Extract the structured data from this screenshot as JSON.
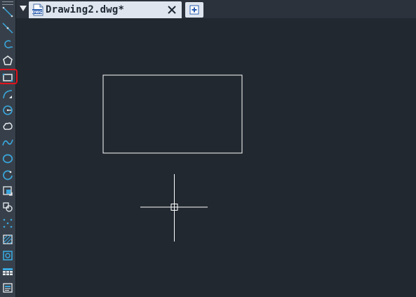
{
  "tab": {
    "title": "Drawing2.dwg*",
    "icon_label": "DWG"
  },
  "colors": {
    "canvas_bg": "#212830",
    "toolbar_bg": "#37404a",
    "tab_bg": "#dfe5ee",
    "accent": "#3aa7de",
    "highlight": "#e0141e"
  },
  "toolbar": {
    "tools": [
      {
        "name": "line-tool-icon"
      },
      {
        "name": "construction-line-tool-icon"
      },
      {
        "name": "polyline-tool-icon"
      },
      {
        "name": "polygon-tool-icon"
      },
      {
        "name": "rectangle-tool-icon",
        "selected": true
      },
      {
        "name": "arc-tool-icon"
      },
      {
        "name": "circle-tool-icon"
      },
      {
        "name": "revision-cloud-tool-icon"
      },
      {
        "name": "spline-tool-icon"
      },
      {
        "name": "ellipse-tool-icon"
      },
      {
        "name": "ellipse-arc-tool-icon"
      },
      {
        "name": "insert-block-tool-icon"
      },
      {
        "name": "make-block-tool-icon"
      },
      {
        "name": "point-tool-icon"
      },
      {
        "name": "hatch-tool-icon"
      },
      {
        "name": "region-tool-icon"
      },
      {
        "name": "table-tool-icon"
      },
      {
        "name": "multiline-text-tool-icon"
      }
    ]
  }
}
